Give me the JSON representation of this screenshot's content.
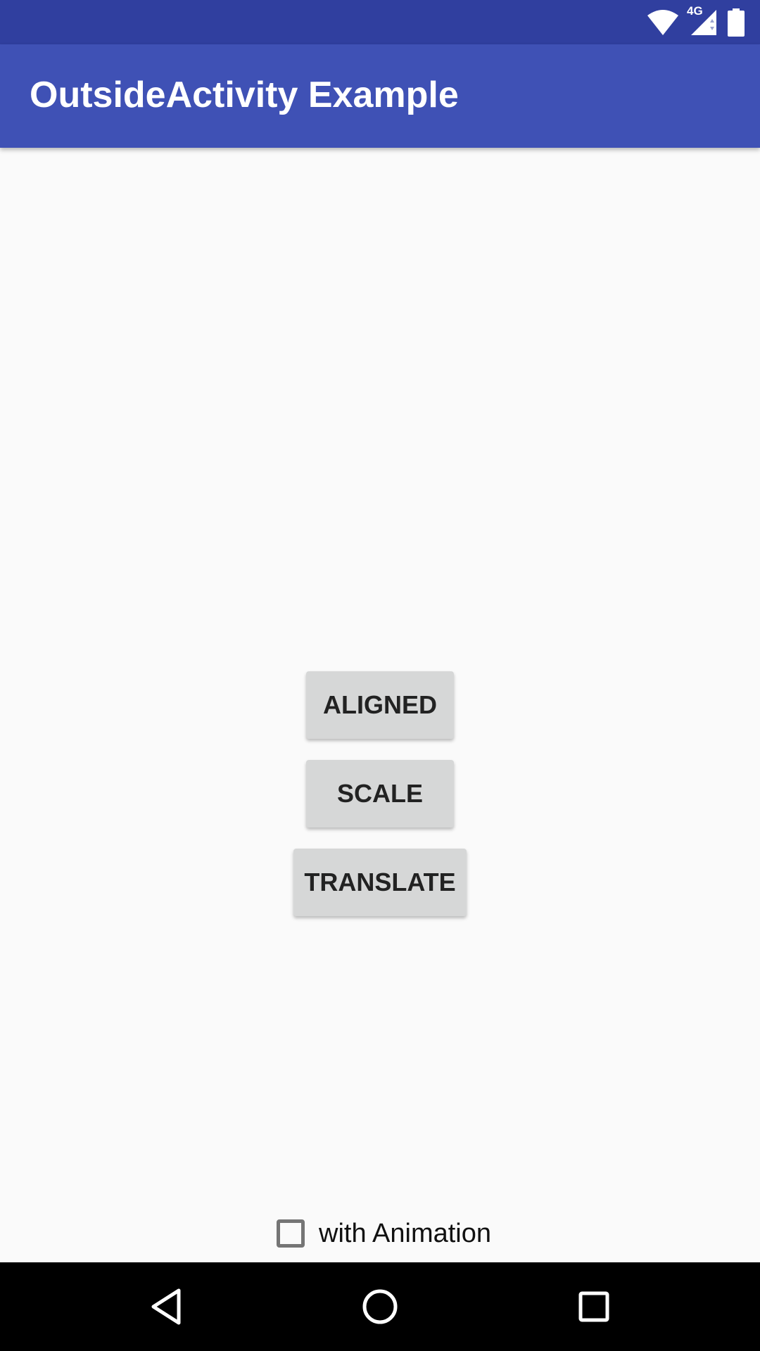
{
  "status_bar": {
    "network_type": "4G",
    "icons": [
      "wifi-icon",
      "cell-signal-icon",
      "battery-icon"
    ],
    "background_color": "#303f9f"
  },
  "app_bar": {
    "title": "OutsideActivity Example",
    "background_color": "#3f51b5"
  },
  "buttons": [
    {
      "label": "ALIGNED"
    },
    {
      "label": "SCALE"
    },
    {
      "label": "TRANSLATE"
    }
  ],
  "animation_checkbox": {
    "label": "with Animation",
    "checked": false
  },
  "nav_bar": {
    "icons": [
      "back-icon",
      "home-icon",
      "recents-icon"
    ]
  }
}
